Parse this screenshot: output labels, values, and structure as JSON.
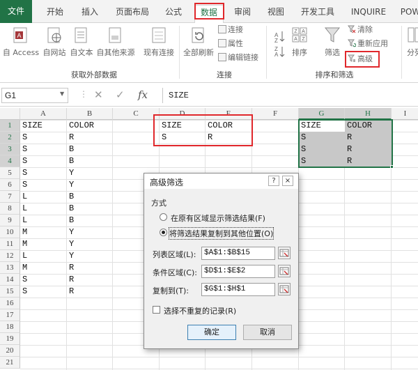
{
  "tabs": {
    "file": "文件",
    "home": "开始",
    "insert": "插入",
    "page_layout": "页面布局",
    "formulas": "公式",
    "data": "数据",
    "review": "审阅",
    "view": "视图",
    "developer": "开发工具",
    "inquire": "INQUIRE",
    "power": "POW"
  },
  "ribbon": {
    "access": "自 Access",
    "web": "自网站",
    "text": "自文本",
    "other_sources": "自其他来源",
    "existing_connections": "现有连接",
    "refresh_all": "全部刷新",
    "connections": "连接",
    "properties": "属性",
    "edit_links": "编辑链接",
    "sort": "排序",
    "filter": "筛选",
    "clear": "清除",
    "reapply": "重新应用",
    "advanced": "高级",
    "split": "分列",
    "group_get_external": "获取外部数据",
    "group_connections": "连接",
    "group_sort_filter": "排序和筛选"
  },
  "formula_bar": {
    "name_box": "G1",
    "fx": "fx",
    "content": "SIZE"
  },
  "columns": [
    "A",
    "B",
    "C",
    "D",
    "E",
    "F",
    "G",
    "H",
    "I"
  ],
  "rows": [
    "1",
    "2",
    "3",
    "4",
    "5",
    "6",
    "7",
    "8",
    "9",
    "10",
    "11",
    "12",
    "13",
    "14",
    "15",
    "16",
    "17",
    "18",
    "19",
    "20",
    "21"
  ],
  "sheet": {
    "A": [
      "SIZE",
      "S",
      "S",
      "S",
      "S",
      "S",
      "L",
      "L",
      "L",
      "M",
      "M",
      "L",
      "M",
      "S",
      "S"
    ],
    "B": [
      "COLOR",
      "R",
      "B",
      "B",
      "Y",
      "Y",
      "B",
      "B",
      "B",
      "Y",
      "Y",
      "Y",
      "R",
      "R",
      "R"
    ],
    "D": [
      "SIZE",
      "S"
    ],
    "E": [
      "COLOR",
      "R"
    ],
    "G": [
      "SIZE",
      "S",
      "S",
      "S"
    ],
    "H": [
      "COLOR",
      "R",
      "R",
      "R"
    ]
  },
  "dialog": {
    "title": "高级筛选",
    "help": "?",
    "close": "×",
    "method_label": "方式",
    "option_in_place": "在原有区域显示筛选结果(F)",
    "option_copy": "将筛选结果复制到其他位置(O)",
    "list_range_label": "列表区域(L):",
    "list_range_value": "$A$1:$B$15",
    "criteria_range_label": "条件区域(C):",
    "criteria_range_value": "$D$1:$E$2",
    "copy_to_label": "复制到(T):",
    "copy_to_value": "$G$1:$H$1",
    "unique_label": "选择不重复的记录(R)",
    "ok": "确定",
    "cancel": "取消",
    "selected_option": "copy",
    "unique_checked": false
  },
  "colors": {
    "excel_green": "#217346",
    "highlight_red": "#e0272b",
    "selection_shade": "#c8c8c8"
  }
}
